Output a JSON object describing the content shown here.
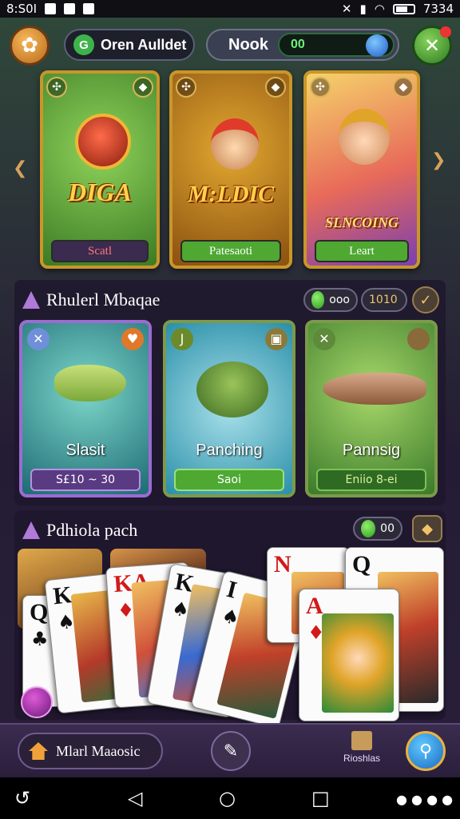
{
  "status_bar": {
    "time": "8:S0I",
    "right_text": "7334"
  },
  "top_bar": {
    "user_label": "Oren Aulldet",
    "nook_label": "Nook",
    "coins": "00"
  },
  "featured_cards": [
    {
      "title": "DIGA",
      "button": "Scatl",
      "bg": "#5aa83a"
    },
    {
      "title": "M:LDIC",
      "button": "Patesaoti",
      "bg": "#c08a1a"
    },
    {
      "title": "SLNCOING",
      "button": "Leart",
      "bg": "#e1a84a"
    }
  ],
  "section1": {
    "title": "Rhulerl Mbaqae",
    "value1": "ooo",
    "value2": "1010"
  },
  "fish_cards": [
    {
      "label": "Slasit",
      "button": "S£10 ~ 30"
    },
    {
      "label": "Panching",
      "button": "Saoi"
    },
    {
      "label": "Pannsig",
      "button": "Eniio 8-ei"
    }
  ],
  "section2": {
    "title": "Pdhiola pach",
    "value": "00"
  },
  "playing_cards": [
    {
      "rank": "Q",
      "suit": "♣",
      "color": "blk"
    },
    {
      "rank": "K",
      "suit": "♠",
      "color": "blk"
    },
    {
      "rank": "KA",
      "suit": "♦",
      "color": "red"
    },
    {
      "rank": "K",
      "suit": "♠",
      "color": "blk"
    },
    {
      "rank": "I",
      "suit": "♠",
      "color": "blk"
    },
    {
      "rank": "N",
      "suit": "",
      "color": "red"
    },
    {
      "rank": "Q",
      "suit": "",
      "color": "blk"
    },
    {
      "rank": "A",
      "suit": "♦",
      "color": "red"
    }
  ],
  "bottom_bar": {
    "home_label": "Mlarl Maaosic",
    "rank_label": "Rioshlas"
  }
}
